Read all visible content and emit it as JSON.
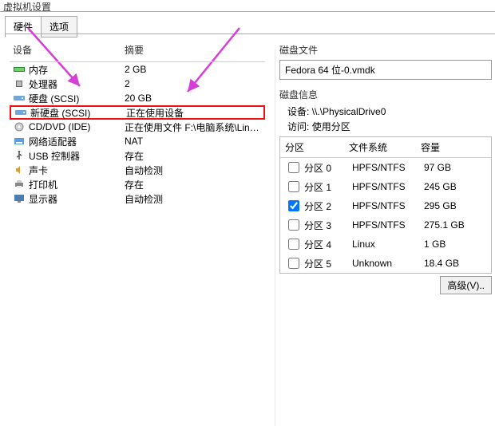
{
  "window_title_fragment": "虚拟机设置",
  "tabs": {
    "hardware": "硬件",
    "options": "选项"
  },
  "hw_header": {
    "device": "设备",
    "summary": "摘要"
  },
  "hw": [
    {
      "icon": "memory-icon",
      "name": "内存",
      "summary": "2 GB"
    },
    {
      "icon": "cpu-icon",
      "name": "处理器",
      "summary": "2"
    },
    {
      "icon": "hdd-icon",
      "name": "硬盘 (SCSI)",
      "summary": "20 GB"
    },
    {
      "icon": "hdd-icon",
      "name": "新硬盘 (SCSI)",
      "summary": "正在使用设备"
    },
    {
      "icon": "cd-icon",
      "name": "CD/DVD (IDE)",
      "summary": "正在使用文件 F:\\电脑系统\\Linu..."
    },
    {
      "icon": "nic-icon",
      "name": "网络适配器",
      "summary": "NAT"
    },
    {
      "icon": "usb-icon",
      "name": "USB 控制器",
      "summary": "存在"
    },
    {
      "icon": "sound-icon",
      "name": "声卡",
      "summary": "自动检测"
    },
    {
      "icon": "printer-icon",
      "name": "打印机",
      "summary": "存在"
    },
    {
      "icon": "display-icon",
      "name": "显示器",
      "summary": "自动检测"
    }
  ],
  "disk_file": {
    "label": "磁盘文件",
    "value": "Fedora 64 位-0.vmdk"
  },
  "disk_info": {
    "label": "磁盘信息",
    "device_label": "设备:",
    "device_value": "\\\\.\\PhysicalDrive0",
    "access_label": "访问:",
    "access_value": "使用分区"
  },
  "part_header": {
    "partition": "分区",
    "fs": "文件系统",
    "capacity": "容量"
  },
  "partitions": [
    {
      "name": "分区 0",
      "fs": "HPFS/NTFS",
      "cap": "97 GB",
      "checked": false
    },
    {
      "name": "分区 1",
      "fs": "HPFS/NTFS",
      "cap": "245 GB",
      "checked": false
    },
    {
      "name": "分区 2",
      "fs": "HPFS/NTFS",
      "cap": "295 GB",
      "checked": true
    },
    {
      "name": "分区 3",
      "fs": "HPFS/NTFS",
      "cap": "275.1 GB",
      "checked": false
    },
    {
      "name": "分区 4",
      "fs": "Linux",
      "cap": "1 GB",
      "checked": false
    },
    {
      "name": "分区 5",
      "fs": "Unknown",
      "cap": "18.4 GB",
      "checked": false
    }
  ],
  "advanced_btn": "高级(V)..",
  "colors": {
    "highlight": "#e11b1b",
    "arrow": "#d63fd6"
  }
}
